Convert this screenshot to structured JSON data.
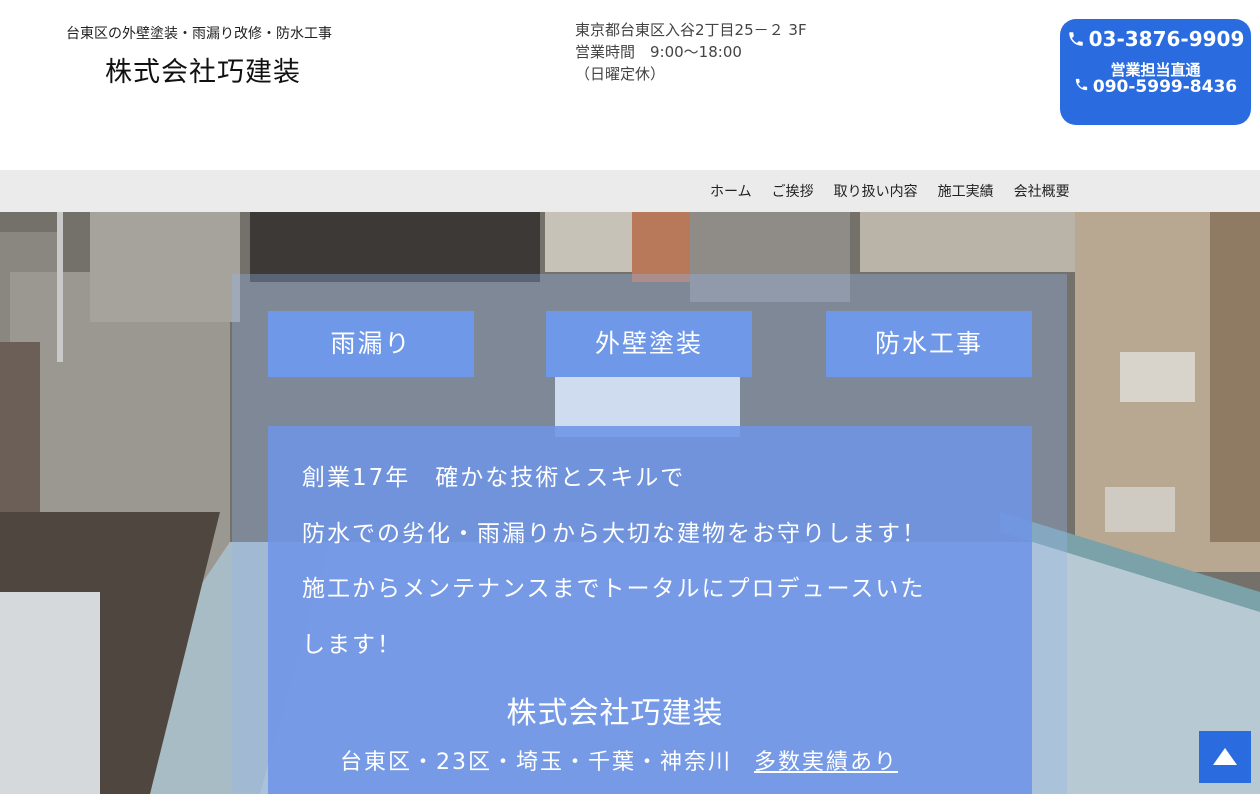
{
  "header": {
    "tagline": "台東区の外壁塗装・雨漏り改修・防水工事",
    "company_name": "株式会社巧建装",
    "address": "東京都台東区入谷2丁目25－２ 3F",
    "hours": "営業時間　9:00〜18:00",
    "closed": "（日曜定休）",
    "phone_main": "03-3876-9909",
    "phone_sub_label": "営業担当直通",
    "phone_mobile": "090-5999-8436"
  },
  "nav": {
    "items": [
      "ホーム",
      "ご挨拶",
      "取り扱い内容",
      "施工実績",
      "会社概要"
    ]
  },
  "hero": {
    "services": [
      "雨漏り",
      "外壁塗装",
      "防水工事"
    ],
    "message_lines": [
      "創業17年　確かな技術とスキルで",
      "防水での劣化・雨漏りから大切な建物をお守りします！",
      "施工からメンテナンスまでトータルにプロデュースいた",
      "します！"
    ],
    "company": "株式会社巧建装",
    "areas": "台東区・23区・埼玉・千葉・神奈川",
    "areas_link": "多数実績あり"
  },
  "colors": {
    "accent": "#2a6ce0",
    "service_button": "#6f98e8",
    "message_box": "#6e94e6",
    "nav_bg": "#ebebeb"
  },
  "icons": {
    "phone": "phone-icon",
    "back_to_top": "triangle-up-icon"
  }
}
